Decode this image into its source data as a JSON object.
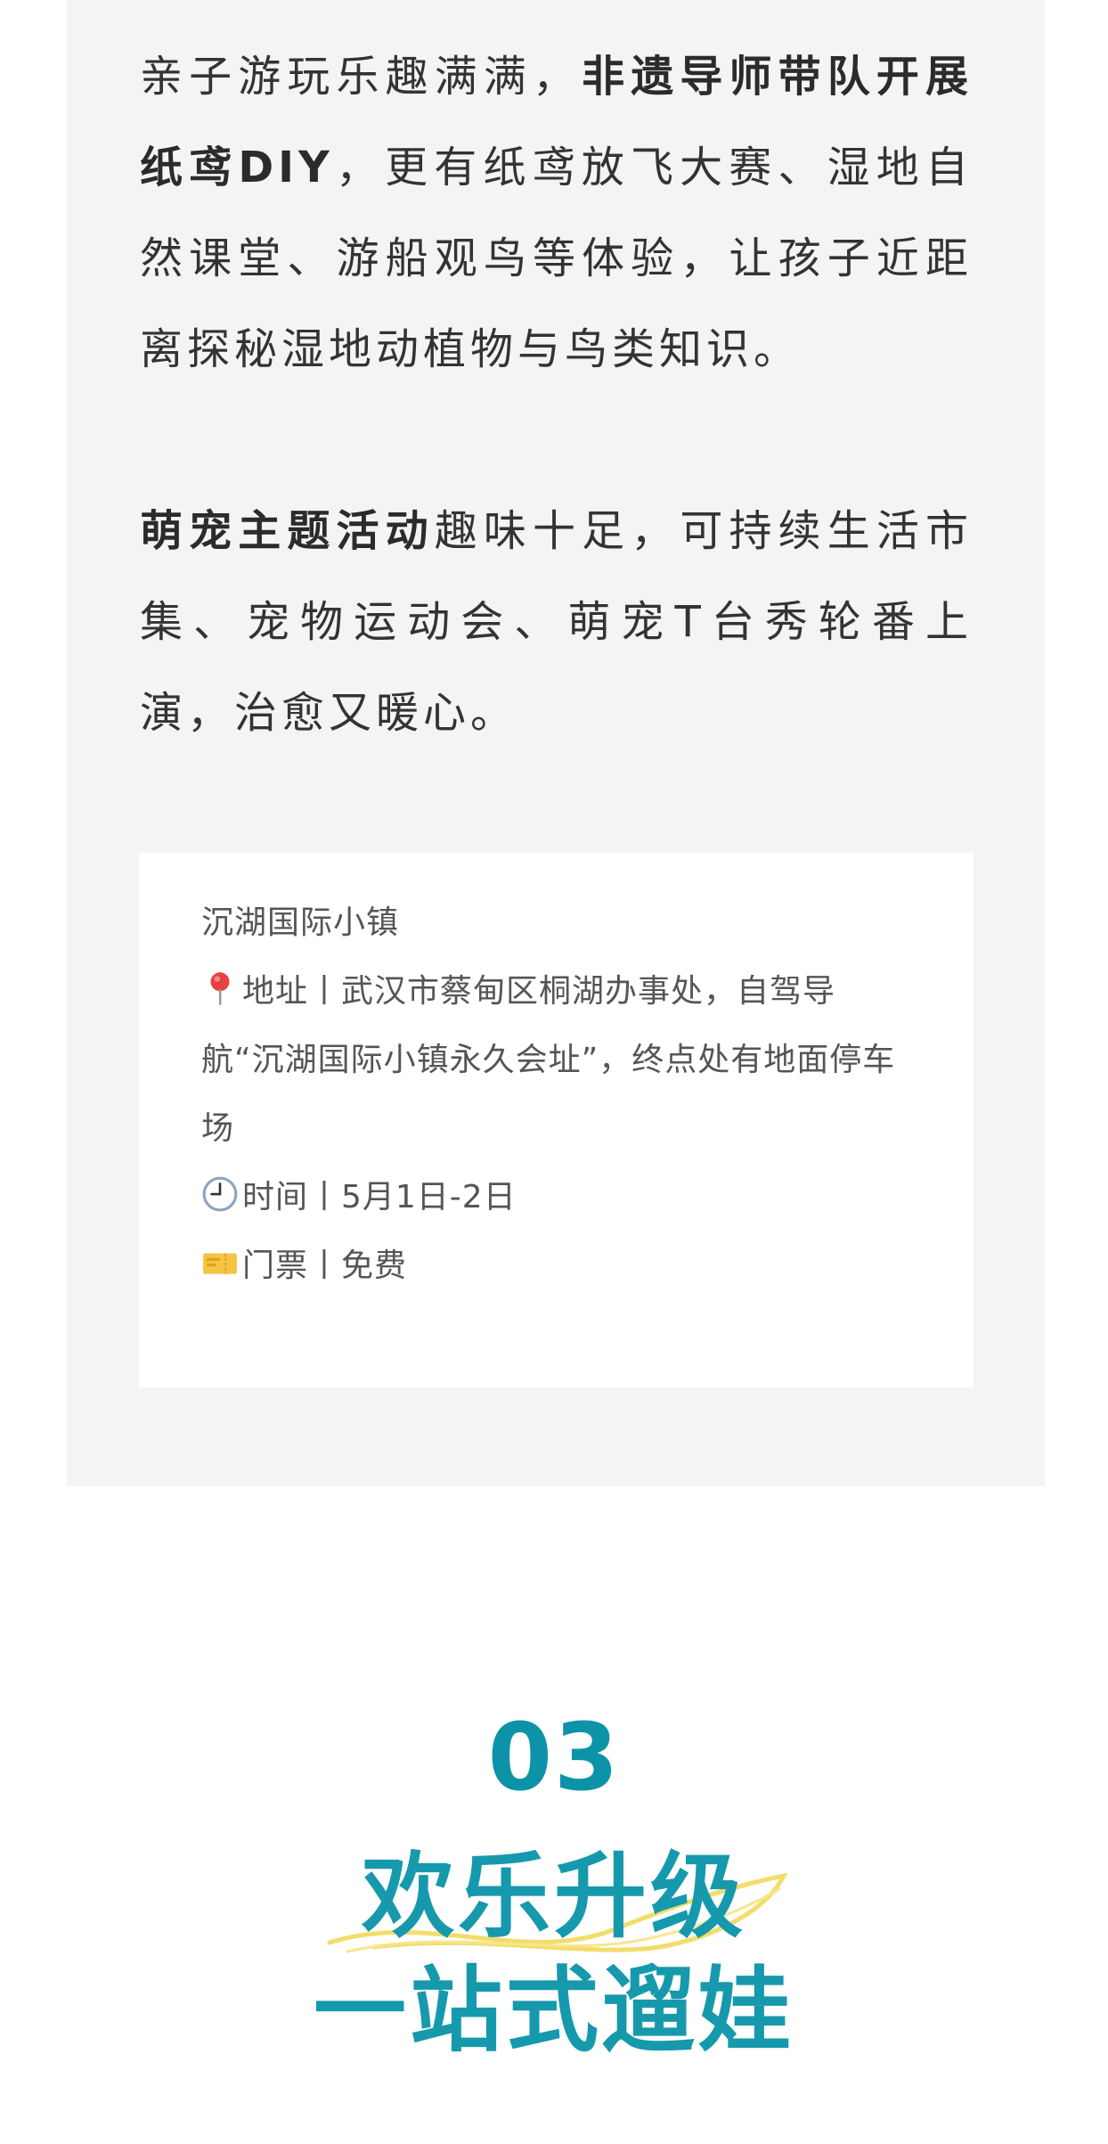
{
  "article": {
    "para1": {
      "t1": "亲子游玩乐趣满满，",
      "b1": "非遗导师带队开展纸鸢DIY",
      "t2": "，更有纸鸢放飞大赛、湿地自然课堂、游船观鸟等体验，让孩子近距离探秘湿地动植物与鸟类知识。"
    },
    "para2": {
      "b1": "萌宠主题活动",
      "t1": "趣味十足，可持续生活市集、宠物运动会、萌宠T台秀轮番上演，治愈又暖心。"
    }
  },
  "info_card": {
    "venue": "沉湖国际小镇",
    "address": "地址丨武汉市蔡甸区桐湖办事处，自驾导航“沉湖国际小镇永久会址”，终点处有地面停车场",
    "time": "时间丨5月1日-2日",
    "ticket": "门票丨免费",
    "icons": [
      "pin-icon",
      "clock-icon",
      "ticket-icon"
    ]
  },
  "section": {
    "number": "03",
    "title_line1": "欢乐升级",
    "title_line2": "一站式遛娃"
  },
  "colors": {
    "panel_bg": "#f4f4f4",
    "accent_teal": "#0d93a8",
    "swoosh_yellow": "#f3dd6a"
  }
}
